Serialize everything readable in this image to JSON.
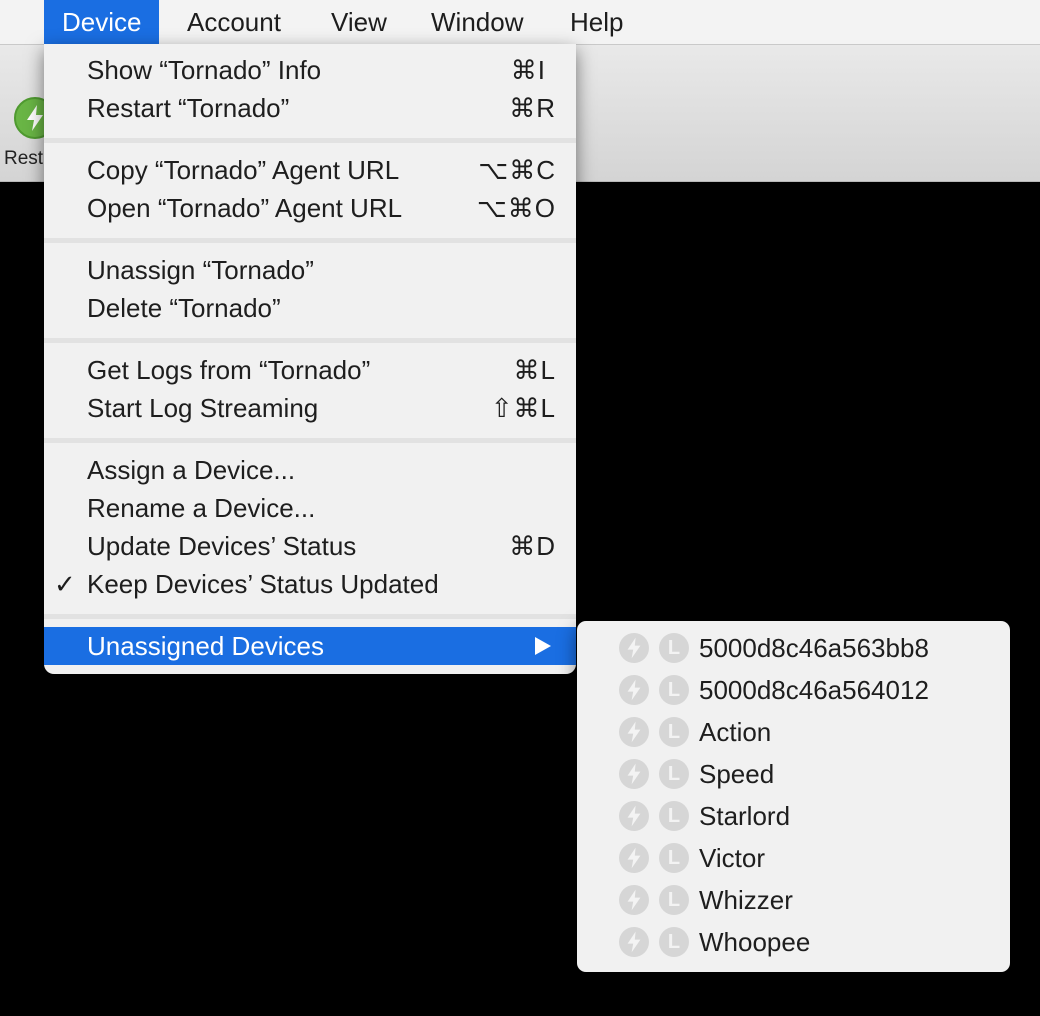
{
  "menubar": {
    "items": [
      "Device",
      "Account",
      "View",
      "Window",
      "Help"
    ],
    "active": "Device"
  },
  "toolbar": {
    "button_label": "Rest",
    "button_icon": "bolt-icon",
    "button_color": "#69b545"
  },
  "device_menu": {
    "items": [
      {
        "label": "Show “Tornado” Info",
        "shortcut": "⌘I"
      },
      {
        "label": "Restart “Tornado”",
        "shortcut": "⌘R"
      },
      {
        "label": "Copy “Tornado” Agent URL",
        "shortcut": "⌥⌘C"
      },
      {
        "label": "Open “Tornado” Agent URL",
        "shortcut": "⌥⌘O"
      },
      {
        "label": "Unassign “Tornado”",
        "shortcut": ""
      },
      {
        "label": "Delete “Tornado”",
        "shortcut": ""
      },
      {
        "label": "Get Logs from “Tornado”",
        "shortcut": "⌘L"
      },
      {
        "label": "Start Log Streaming",
        "shortcut": "⇧⌘L"
      },
      {
        "label": "Assign a Device...",
        "shortcut": ""
      },
      {
        "label": "Rename a Device...",
        "shortcut": ""
      },
      {
        "label": "Update Devices’ Status",
        "shortcut": "⌘D"
      },
      {
        "label": "Keep Devices’ Status Updated",
        "shortcut": "",
        "checkmark": "✓"
      },
      {
        "label": "Unassigned Devices",
        "submenu": true,
        "highlighted": true
      }
    ]
  },
  "submenu": {
    "icon_names": [
      "bolt-icon",
      "letter-l-icon"
    ],
    "icon_letter": "L",
    "icon_color": "#d6d6d6",
    "items": [
      "5000d8c46a563bb8",
      "5000d8c46a564012",
      "Action",
      "Speed",
      "Starlord",
      "Victor",
      "Whizzer",
      "Whoopee"
    ]
  },
  "colors": {
    "highlight": "#1a6ee2",
    "menu_bg": "#f1f1f1",
    "background": "#000000"
  }
}
